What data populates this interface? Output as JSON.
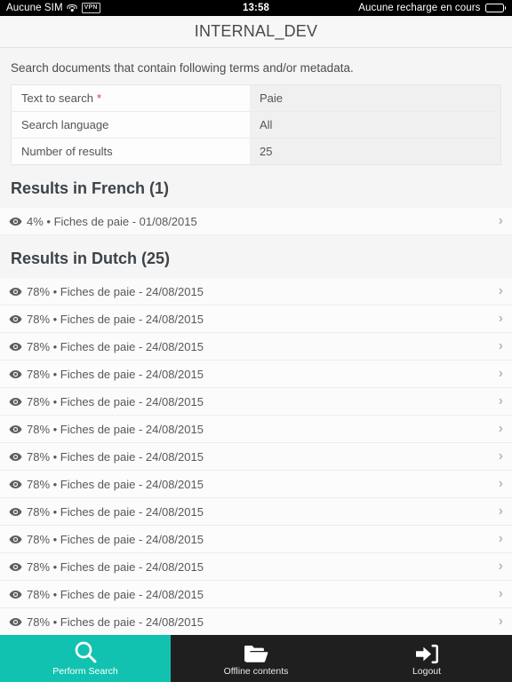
{
  "statusbar": {
    "carrier": "Aucune SIM",
    "wifi_icon": "wifi-icon",
    "vpn_badge": "VPN",
    "time": "13:58",
    "charge_status": "Aucune recharge en cours",
    "battery_icon": "battery-icon"
  },
  "navbar": {
    "title": "INTERNAL_DEV"
  },
  "main": {
    "intro": "Search documents that contain following terms and/or metadata.",
    "form_rows": [
      {
        "label": "Text to search",
        "required": "*",
        "value": "Paie"
      },
      {
        "label": "Search language",
        "required": "",
        "value": "All"
      },
      {
        "label": "Number of results",
        "required": "",
        "value": "25"
      }
    ],
    "sections": [
      {
        "heading": "Results in French (1)",
        "rows": [
          {
            "icon": "eye-icon",
            "text": "4% • Fiches de paie - 01/08/2015",
            "chevron": "›"
          }
        ]
      },
      {
        "heading": "Results in Dutch (25)",
        "rows": [
          {
            "icon": "eye-icon",
            "text": "78% • Fiches de paie - 24/08/2015",
            "chevron": "›"
          },
          {
            "icon": "eye-icon",
            "text": "78% • Fiches de paie - 24/08/2015",
            "chevron": "›"
          },
          {
            "icon": "eye-icon",
            "text": "78% • Fiches de paie - 24/08/2015",
            "chevron": "›"
          },
          {
            "icon": "eye-icon",
            "text": "78% • Fiches de paie - 24/08/2015",
            "chevron": "›"
          },
          {
            "icon": "eye-icon",
            "text": "78% • Fiches de paie - 24/08/2015",
            "chevron": "›"
          },
          {
            "icon": "eye-icon",
            "text": "78% • Fiches de paie - 24/08/2015",
            "chevron": "›"
          },
          {
            "icon": "eye-icon",
            "text": "78% • Fiches de paie - 24/08/2015",
            "chevron": "›"
          },
          {
            "icon": "eye-icon",
            "text": "78% • Fiches de paie - 24/08/2015",
            "chevron": "›"
          },
          {
            "icon": "eye-icon",
            "text": "78% • Fiches de paie - 24/08/2015",
            "chevron": "›"
          },
          {
            "icon": "eye-icon",
            "text": "78% • Fiches de paie - 24/08/2015",
            "chevron": "›"
          },
          {
            "icon": "eye-icon",
            "text": "78% • Fiches de paie - 24/08/2015",
            "chevron": "›"
          },
          {
            "icon": "eye-icon",
            "text": "78% • Fiches de paie - 24/08/2015",
            "chevron": "›"
          },
          {
            "icon": "eye-icon",
            "text": "78% • Fiches de paie - 24/08/2015",
            "chevron": "›"
          }
        ]
      }
    ]
  },
  "tabbar": {
    "active_index": 0,
    "tabs": [
      {
        "icon": "search-icon",
        "label": "Perform Search"
      },
      {
        "icon": "folder-open-icon",
        "label": "Offline contents"
      },
      {
        "icon": "logout-icon",
        "label": "Logout"
      }
    ]
  },
  "colors": {
    "accent_teal": "#12c2b0",
    "tabbar_dark": "#1f1f1f",
    "required_red": "#e23b3b",
    "page_bg": "#f5f5f5"
  }
}
